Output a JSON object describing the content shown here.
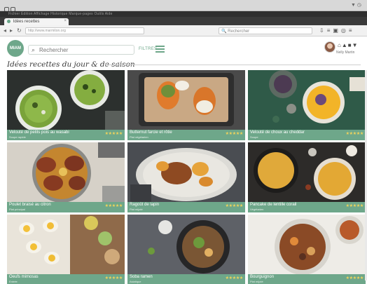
{
  "browser": {
    "tab_title": "Idées recettes",
    "url": "http://www.marmiton.org",
    "search_placeholder": "Rechercher",
    "menu_text": "Fichier  Édition  Affichage  Historique  Marque-pages  Outils  Aide"
  },
  "app": {
    "logo_text": "MIAM",
    "search_placeholder": "Rechercher",
    "filters_label": "FILTRES",
    "user_name": "Nelly Martin"
  },
  "page": {
    "heading": "Idées recettes du jour & de saison"
  },
  "cards": [
    {
      "title": "Velouté de petits pois au wasabi",
      "sub": "Soupe rapide",
      "stars": "★★★★★"
    },
    {
      "title": "Butternut farcie et rôtie",
      "sub": "Plat végétarien",
      "stars": "★★★★★"
    },
    {
      "title": "Velouté de choux au cheddar",
      "sub": "Soupe",
      "stars": "★★★★★"
    },
    {
      "title": "Poulet braisé au citron",
      "sub": "Plat principal",
      "stars": "★★★★★"
    },
    {
      "title": "Ragoût de lapin",
      "sub": "Plat mijoté",
      "stars": "★★★★★"
    },
    {
      "title": "Pancake de lentille corail",
      "sub": "Végétarien",
      "stars": "★★★★★"
    },
    {
      "title": "Oeufs mimosas",
      "sub": "Entrée",
      "stars": "★★★★★"
    },
    {
      "title": "Soba ramen",
      "sub": "Asiatique",
      "stars": "★★★★★"
    },
    {
      "title": "Bourguignon",
      "sub": "Plat mijoté",
      "stars": "★★★★★"
    }
  ],
  "colors": {
    "accent": "#6ea78a",
    "star": "#f2d35b"
  }
}
